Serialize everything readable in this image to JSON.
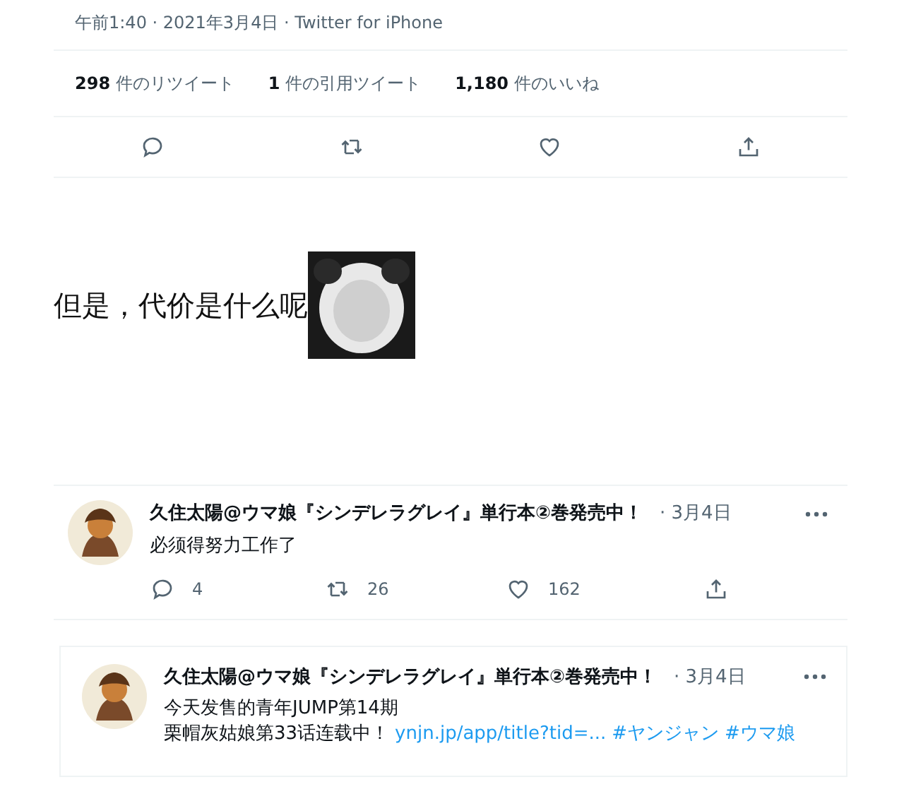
{
  "tweet": {
    "meta": "午前1:40 · 2021年3月4日 · Twitter for iPhone",
    "stats": [
      {
        "count": "298",
        "label": "件のリツイート"
      },
      {
        "count": "1",
        "label": "件の引用ツイート"
      },
      {
        "count": "1,180",
        "label": "件のいいね"
      }
    ]
  },
  "caption": "但是，代价是什么呢",
  "replies": [
    {
      "name": "久住太陽@ウマ娘『シンデレラグレイ』単行本②巻発売中！",
      "date": "· 3月4日",
      "lines": [
        [
          {
            "kind": "text",
            "text": "必须得努力工作了"
          }
        ]
      ],
      "actions": {
        "replies": "4",
        "retweets": "26",
        "likes": "162"
      }
    },
    {
      "name": "久住太陽@ウマ娘『シンデレラグレイ』単行本②巻発売中！",
      "date": "· 3月4日",
      "lines": [
        [
          {
            "kind": "text",
            "text": "今天发售的青年JUMP第14期"
          }
        ],
        [
          {
            "kind": "text",
            "text": "栗帽灰姑娘第33话连载中！"
          },
          {
            "kind": "link",
            "text": "ynjn.jp/app/title?tid=..."
          },
          {
            "kind": "link",
            "text": "#ヤンジャン"
          },
          {
            "kind": "link",
            "text": "#ウマ娘"
          }
        ]
      ]
    }
  ]
}
